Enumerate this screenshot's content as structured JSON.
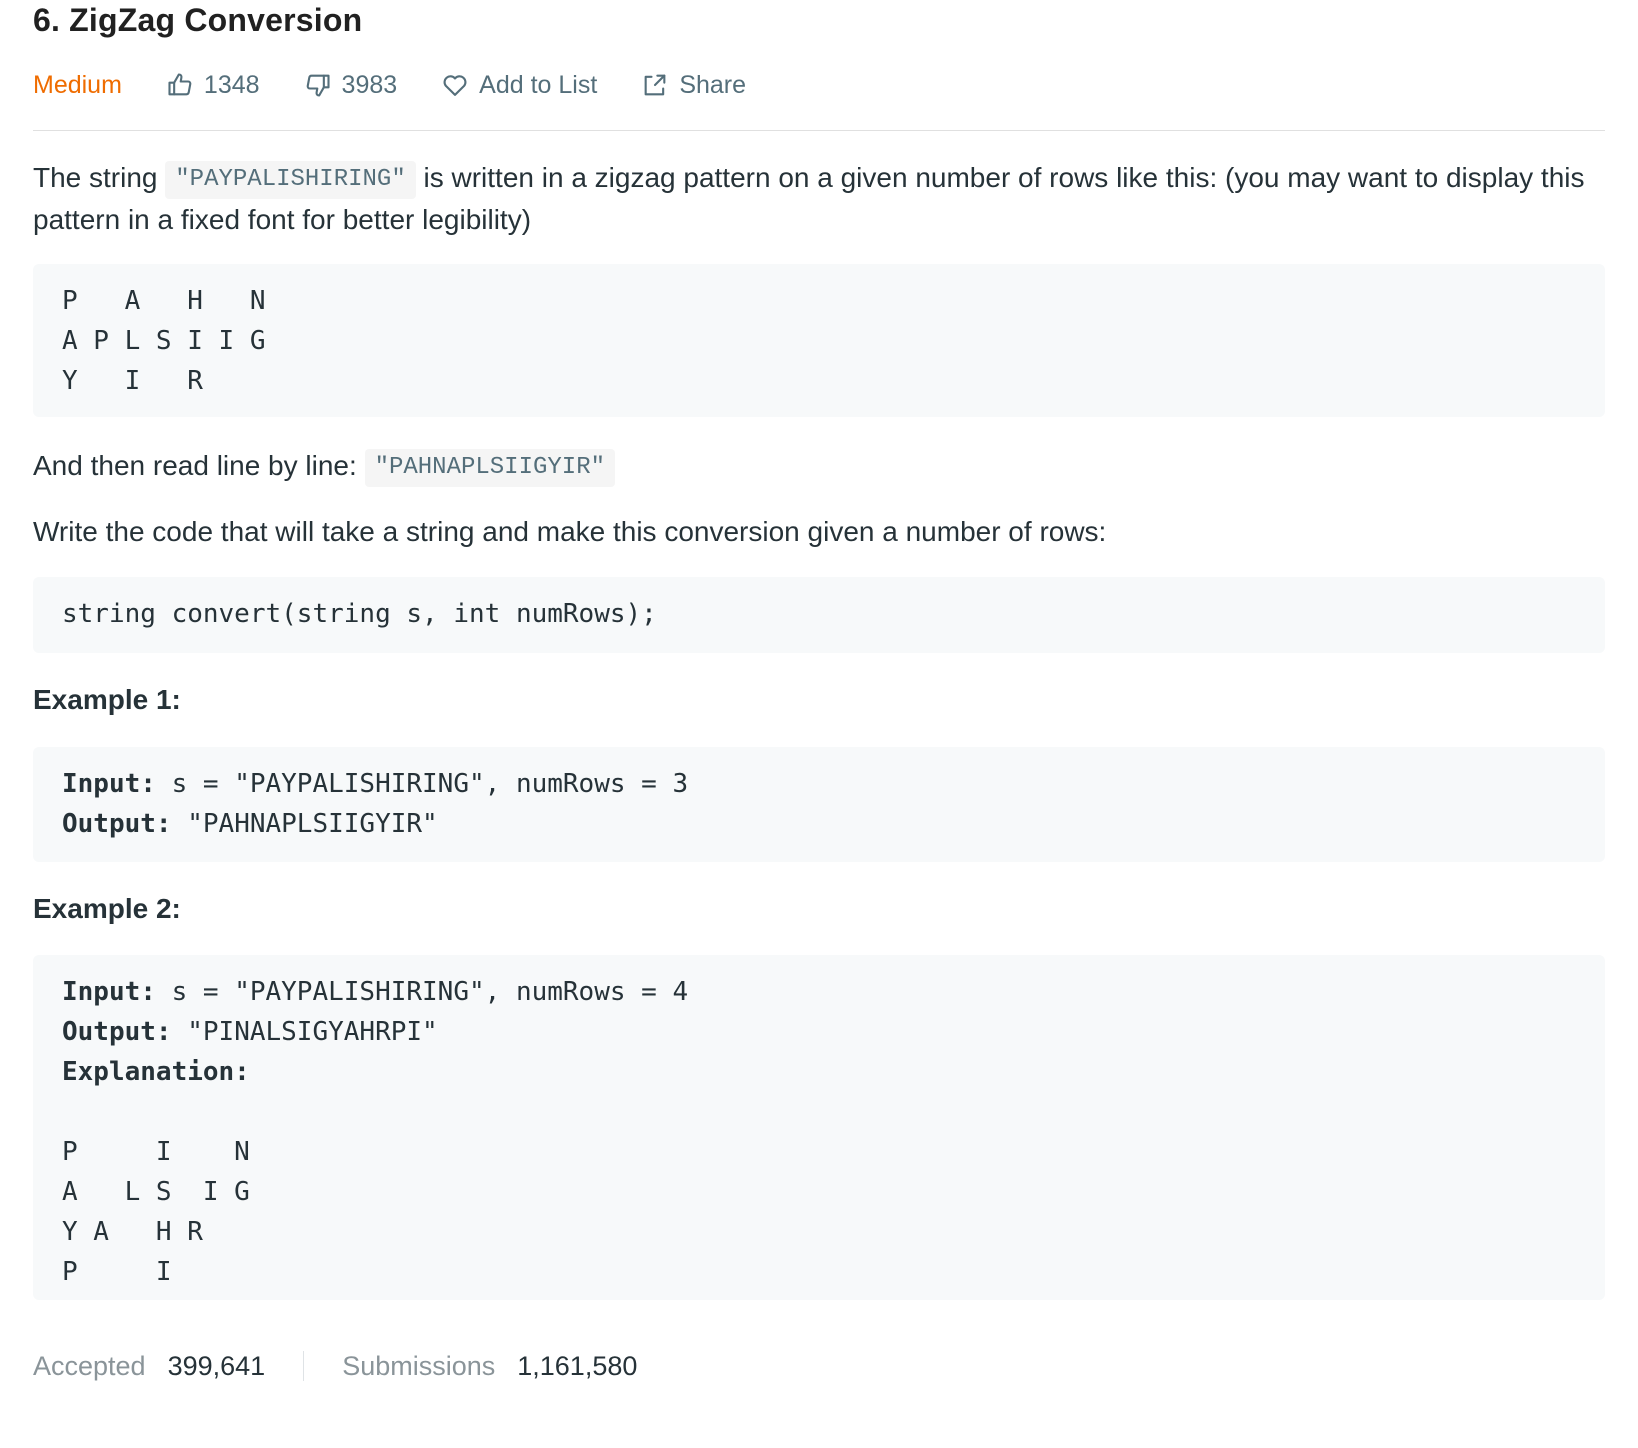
{
  "problem": {
    "title": "6. ZigZag Conversion",
    "difficulty": "Medium",
    "likes": "1348",
    "dislikes": "3983",
    "add_to_list_label": "Add to List",
    "share_label": "Share"
  },
  "description": {
    "p1_before": "The string ",
    "p1_code": "\"PAYPALISHIRING\"",
    "p1_after": " is written in a zigzag pattern on a given number of rows like this: (you may want to display this pattern in a fixed font for better legibility)",
    "pattern_block": "P   A   H   N\nA P L S I I G\nY   I   R",
    "p2_before": "And then read line by line: ",
    "p2_code": "\"PAHNAPLSIIGYIR\"",
    "p3": "Write the code that will take a string and make this conversion given a number of rows:",
    "signature": "string convert(string s, int numRows);"
  },
  "examples": [
    {
      "title": "Example 1:",
      "input_label": "Input:",
      "input_value": " s = \"PAYPALISHIRING\", numRows = 3",
      "output_label": "Output:",
      "output_value": " \"PAHNAPLSIIGYIR\""
    },
    {
      "title": "Example 2:",
      "input_label": "Input:",
      "input_value": " s = \"PAYPALISHIRING\", numRows = 4",
      "output_label": "Output:",
      "output_value": " \"PINALSIGYAHRPI\"",
      "explanation_label": "Explanation:",
      "explanation_pattern": "P     I    N\nA   L S  I G\nY A   H R\nP     I"
    }
  ],
  "stats": {
    "accepted_label": "Accepted",
    "accepted_value": "399,641",
    "submissions_label": "Submissions",
    "submissions_value": "1,161,580"
  },
  "colors": {
    "difficulty_medium": "#ef6c00",
    "code_background": "#f7f9fa",
    "meta_text": "#546e7a"
  },
  "icons": {
    "like": "thumbs-up-icon",
    "dislike": "thumbs-down-icon",
    "add_to_list": "heart-icon",
    "share": "share-icon"
  }
}
